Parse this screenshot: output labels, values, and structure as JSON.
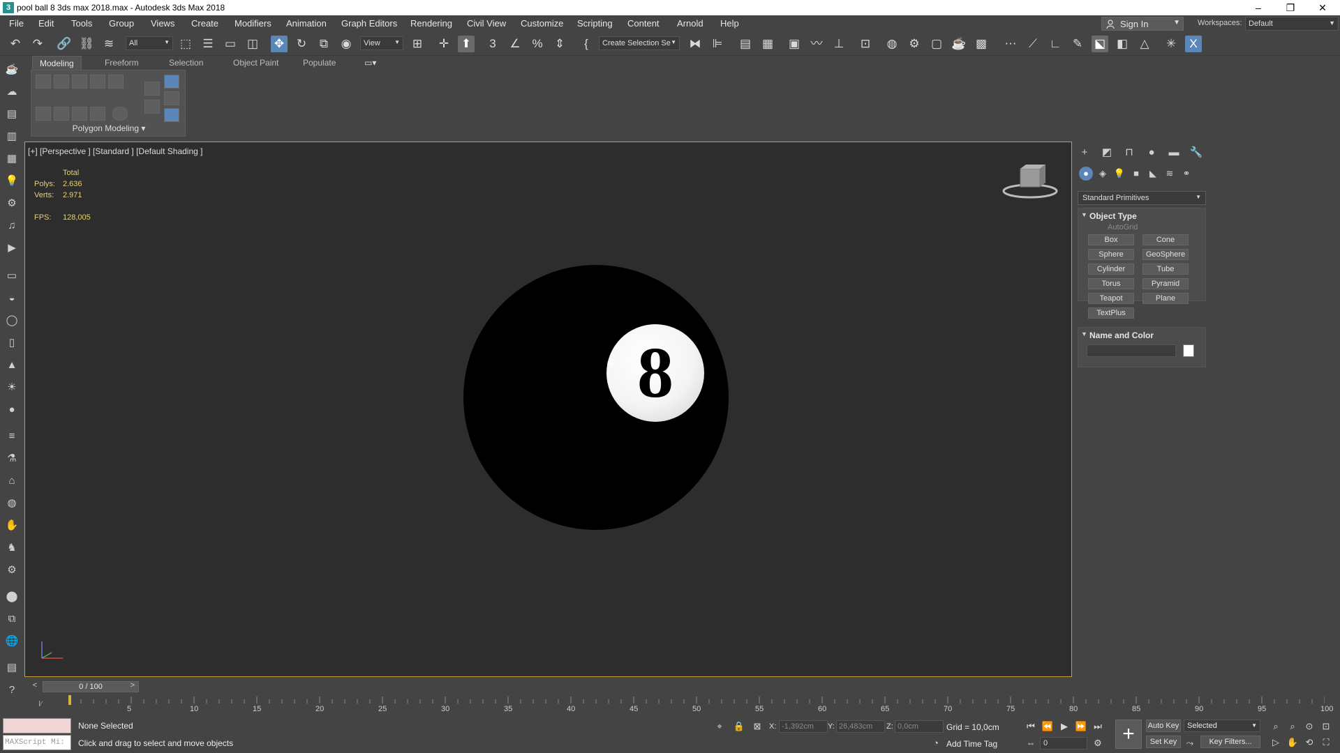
{
  "window": {
    "title": "pool ball 8 3ds max 2018.max - Autodesk 3ds Max 2018",
    "minimize": "–",
    "restore": "❐",
    "close": "✕"
  },
  "menu": {
    "items": [
      "File",
      "Edit",
      "Tools",
      "Group",
      "Views",
      "Create",
      "Modifiers",
      "Animation",
      "Graph Editors",
      "Rendering",
      "Civil View",
      "Customize",
      "Scripting",
      "Content",
      "Arnold",
      "Help"
    ],
    "sign_in": "Sign In",
    "workspaces_label": "Workspaces:",
    "workspaces_value": "Default"
  },
  "toolbar": {
    "selection_filter": "All",
    "reference_coord": "View",
    "named_selection": "Create Selection Se"
  },
  "ribbon": {
    "tabs": [
      "Modeling",
      "Freeform",
      "Selection",
      "Object Paint",
      "Populate"
    ],
    "panel_label": "Polygon Modeling ▾"
  },
  "viewport": {
    "label": "[+] [Perspective ] [Standard ] [Default Shading ]",
    "stats": {
      "total_label": "Total",
      "polys_label": "Polys:",
      "polys_value": "2.636",
      "verts_label": "Verts:",
      "verts_value": "2.971",
      "fps_label": "FPS:",
      "fps_value": "128,005"
    },
    "ball_number": "8"
  },
  "command_panel": {
    "primitive_dropdown": "Standard Primitives",
    "object_type_title": "Object Type",
    "autogrid_label": "AutoGrid",
    "primitives": [
      "Box",
      "Cone",
      "Sphere",
      "GeoSphere",
      "Cylinder",
      "Tube",
      "Torus",
      "Pyramid",
      "Teapot",
      "Plane",
      "TextPlus"
    ],
    "name_color_title": "Name and Color",
    "name_value": ""
  },
  "timeline": {
    "frame_display": "0 / 100",
    "ticks": [
      "5",
      "10",
      "15",
      "20",
      "25",
      "30",
      "35",
      "40",
      "45",
      "50",
      "55",
      "60",
      "65",
      "70",
      "75",
      "80",
      "85",
      "90",
      "95",
      "100"
    ]
  },
  "status": {
    "maxscript_placeholder": "MAXScript Mi:",
    "selection": "None Selected",
    "prompt": "Click and drag to select and move objects",
    "x_label": "X:",
    "x_value": "-1,392cm",
    "y_label": "Y:",
    "y_value": "26,483cm",
    "z_label": "Z:",
    "z_value": "0,0cm",
    "grid": "Grid = 10,0cm",
    "add_time_tag": "Add Time Tag",
    "current_frame": "0",
    "auto_key": "Auto Key",
    "set_key": "Set Key",
    "selected_dropdown": "Selected",
    "key_filters": "Key Filters..."
  },
  "colors": {
    "accent": "#5b86b8",
    "viewport_border": "#c6a13a",
    "stats_text": "#e2d27a"
  }
}
